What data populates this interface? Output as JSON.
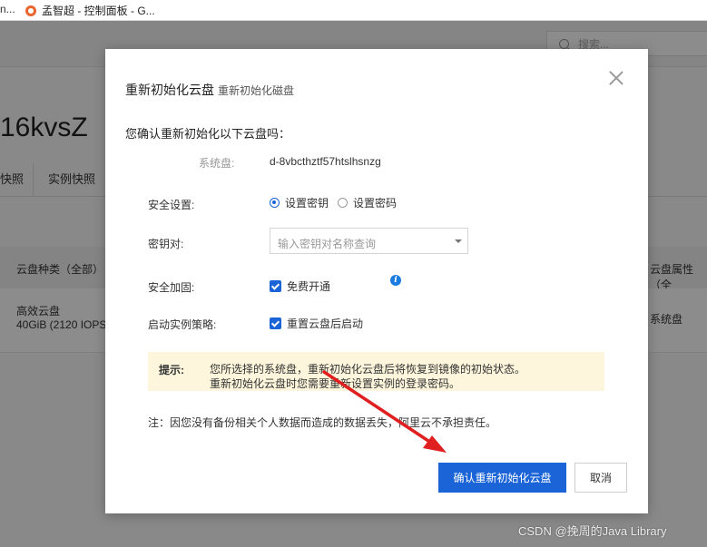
{
  "browser": {
    "bookmark_left": "n...",
    "bookmark_label": "孟智超 - 控制面板 - G..."
  },
  "background": {
    "search_placeholder": "搜索...",
    "page_title": "16kvsZ",
    "tabs": [
      "快照",
      "实例快照"
    ],
    "table_headers": {
      "type": "云盘种类（全部）",
      "attr": "云盘属性（全"
    },
    "row": {
      "type": "高效云盘",
      "spec": "40GiB (2120 IOPS)",
      "attr": "系统盘"
    }
  },
  "dialog": {
    "title": "重新初始化云盘",
    "subtitle": "重新初始化磁盘",
    "confirm_question": "您确认重新初始化以下云盘吗：",
    "system_disk_label": "系统盘:",
    "system_disk_id": "d-8vbcthztf57htslhsnzg",
    "security_label": "安全设置:",
    "security_options": [
      {
        "label": "设置密钥",
        "selected": true
      },
      {
        "label": "设置密码",
        "selected": false
      }
    ],
    "keypair_label": "密钥对:",
    "keypair_placeholder": "输入密钥对名称查询",
    "hardening_label": "安全加固:",
    "hardening_option": "免费开通",
    "hardening_checked": true,
    "startup_label": "启动实例策略:",
    "startup_option": "重置云盘后启动",
    "startup_checked": true,
    "notice_label": "提示:",
    "notice_line1": "您所选择的系统盘，重新初始化云盘后将恢复到镜像的初始状态。",
    "notice_line2": "重新初始化云盘时您需要重新设置实例的登录密码。",
    "footnote": "注：因您没有备份相关个人数据而造成的数据丢失，阿里云不承担责任。",
    "confirm_button": "确认重新初始化云盘",
    "cancel_button": "取消"
  },
  "watermark": "CSDN @挽周的Java Library",
  "colors": {
    "primary": "#1b64d8",
    "notice_bg": "#fdf6dc",
    "arrow": "#e02020"
  }
}
